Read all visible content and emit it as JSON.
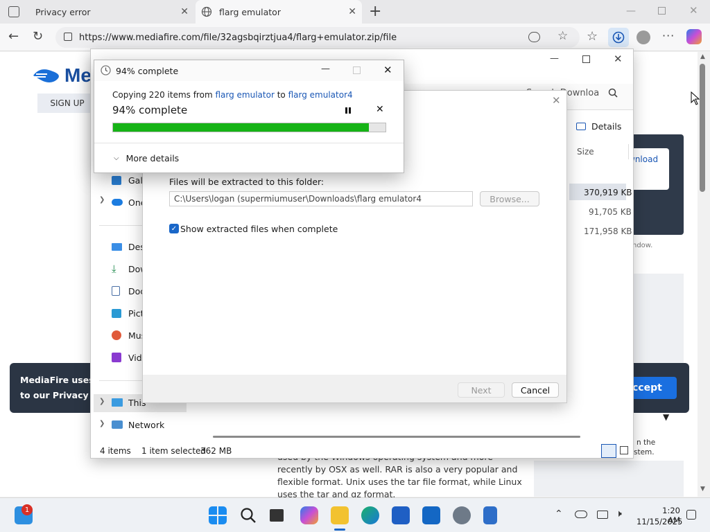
{
  "browser": {
    "tabs": [
      {
        "title": "Privacy error",
        "active": false
      },
      {
        "title": "flarg emulator",
        "active": true
      }
    ],
    "url": "https://www.mediafire.com/file/32agsbqirztjua4/flarg+emulator.zip/file"
  },
  "page": {
    "logo_text": "Me",
    "signup_label": "SIGN UP",
    "download_label": "wnload",
    "window_text": "ndow.",
    "cookie_text": [
      "MediaFire uses c",
      "to our Privacy Po"
    ],
    "accept_label": "ccept",
    "body_text": [
      "used by the Windows operating system and more",
      "recently by OSX as well. RAR is also a very popular and",
      "flexible format. Unix uses the tar file format, while Linux",
      "uses the tar and gz format."
    ],
    "side_text": [
      "n the",
      "stem."
    ]
  },
  "explorer": {
    "search_label": "Search Downloa",
    "column_size": "Size",
    "file_sizes": [
      "370,919 KB",
      "91,705 KB",
      "171,958 KB"
    ],
    "nav": {
      "gallery": "Gall",
      "onedrive": "One",
      "desktop": "Desk",
      "downloads": "Dow",
      "documents": "Doc",
      "pictures": "Pict",
      "music": "Mus",
      "videos": "Vide",
      "thispc": "This",
      "network": "Network"
    },
    "status": {
      "items": "4 items",
      "selected": "1 item selected",
      "size": "362 MB"
    }
  },
  "extract": {
    "folder_label": "Files will be extracted to this folder:",
    "path": "C:\\Users\\logan (supermiumuser\\Downloads\\flarg emulator4",
    "browse_label": "Browse...",
    "show_files_label": "Show extracted files when complete",
    "show_files_checked": true,
    "next_label": "Next",
    "cancel_label": "Cancel"
  },
  "progress": {
    "title": "94% complete",
    "copy_prefix": "Copying 220 items from",
    "source": "flarg emulator",
    "to_word": "to",
    "dest": "flarg emulator4",
    "status": "94% complete",
    "percent": 94,
    "more_details": "More details",
    "bar_color": "#16b316"
  },
  "taskbar": {
    "time": "1:20 AM",
    "date": "11/15/2025",
    "notification_count": "1"
  }
}
